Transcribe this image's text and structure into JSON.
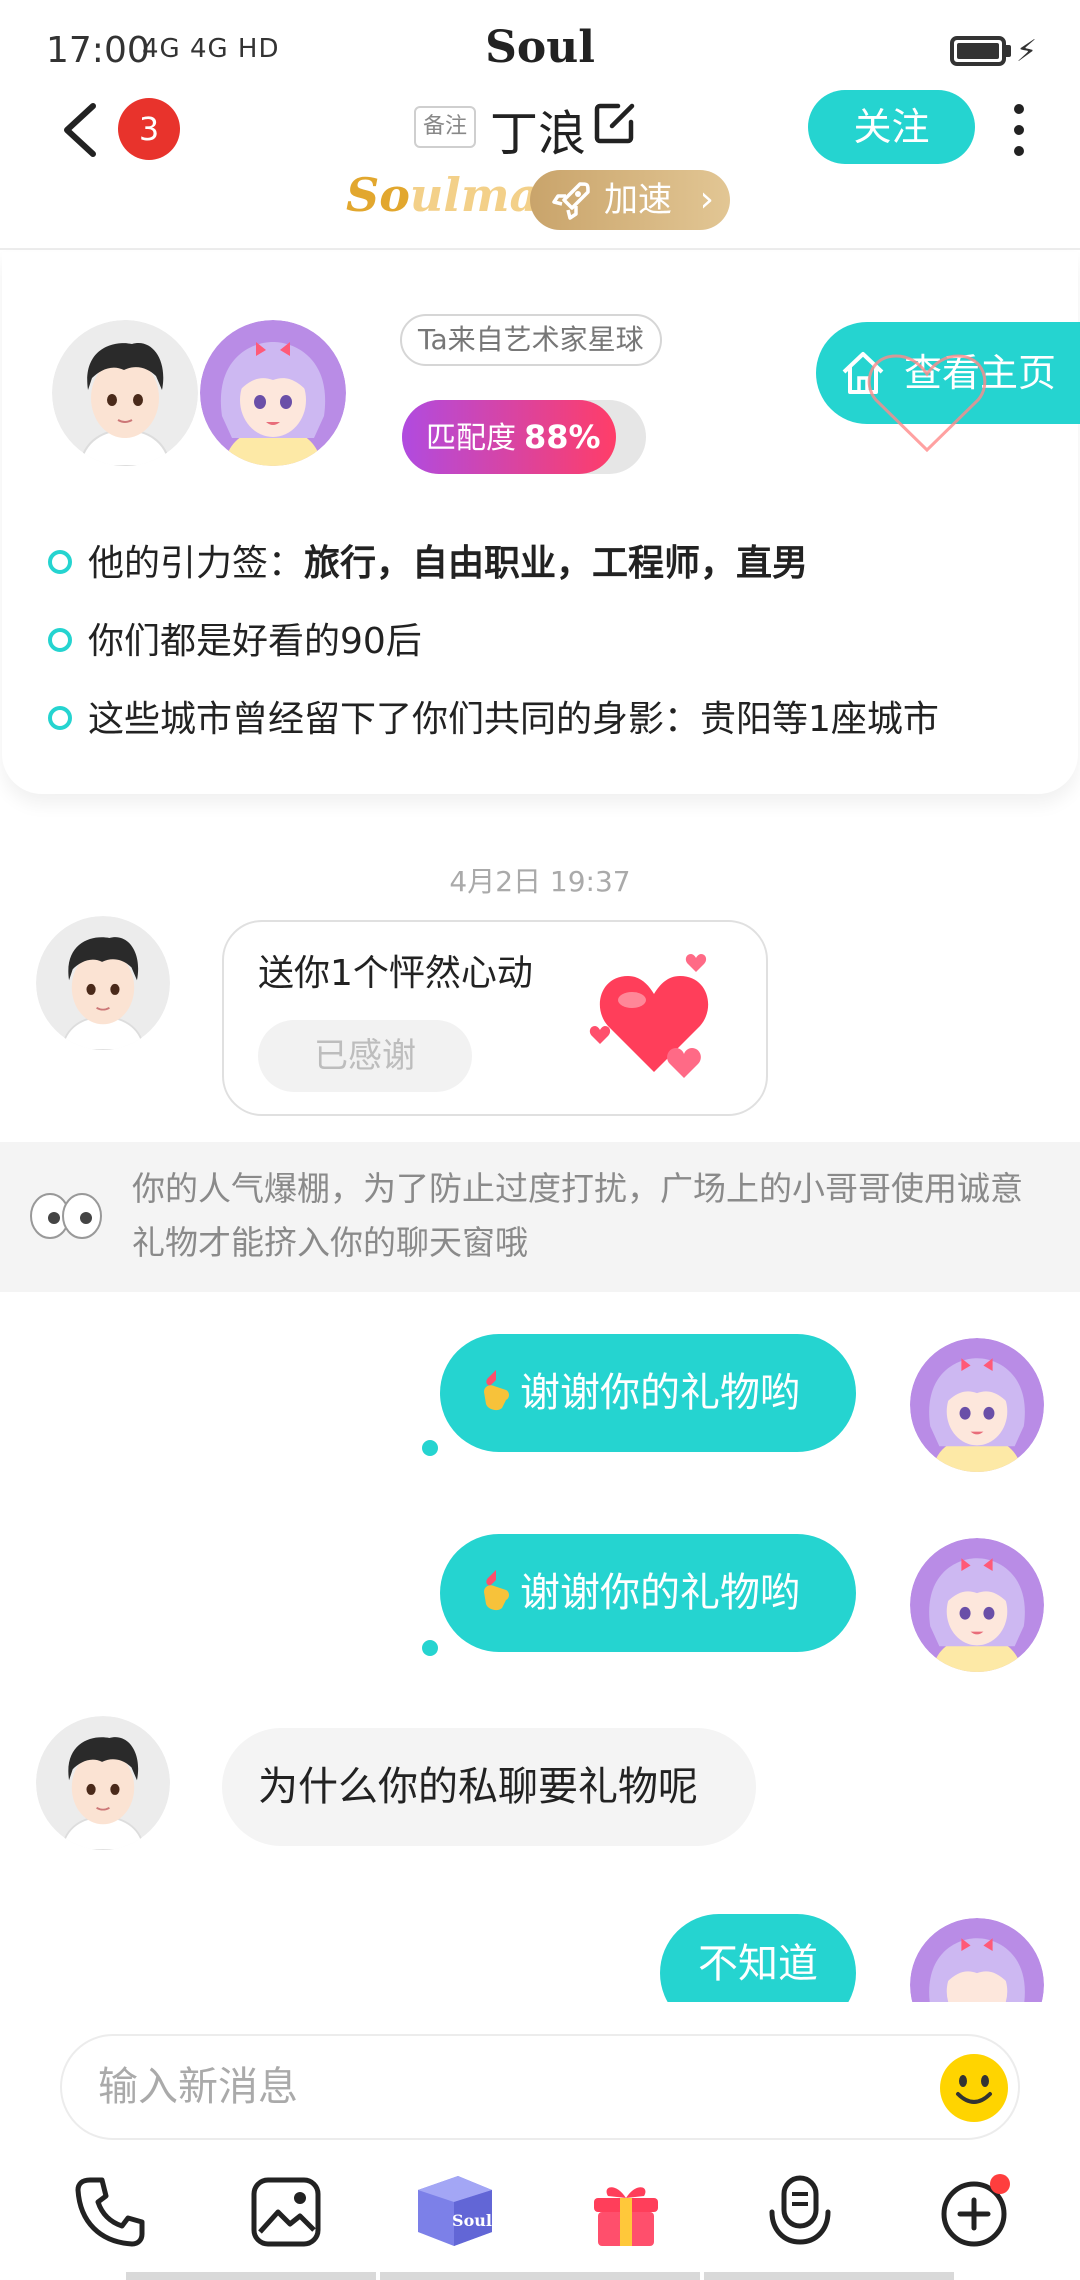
{
  "status_bar": {
    "time": "17:00",
    "network": "4G 4G HD",
    "app_name": "Soul"
  },
  "header": {
    "unread_count": "3",
    "remark_label": "备注",
    "contact_name": "丁浪",
    "follow_label": "关注",
    "soulmate_brand": "Soulmate",
    "speedup_label": "加速",
    "accent_color": "#25d4d0"
  },
  "match_card": {
    "origin": "Ta来自艺术家星球",
    "match_label": "匹配度",
    "match_value": "88%",
    "match_fraction": 0.88,
    "homepage_label": "查看主页",
    "tags_prefix": "他的引力签：",
    "tags": "旅行，自由职业，工程师，直男",
    "common_line": "你们都是好看的90后",
    "cities_line": "这些城市曾经留下了你们共同的身影：贵阳等1座城市"
  },
  "chat": {
    "timestamp": "4月2日 19:37",
    "gift_text": "送你1个怦然心动",
    "gift_status": "已感谢",
    "notice": "你的人气爆棚，为了防止过度打扰，广场上的小哥哥使用诚意礼物才能挤入你的聊天窗哦",
    "messages": [
      {
        "from": "me",
        "text": "谢谢你的礼物哟",
        "emoji": "hand-heart"
      },
      {
        "from": "me",
        "text": "谢谢你的礼物哟",
        "emoji": "hand-heart"
      },
      {
        "from": "them",
        "text": "为什么你的私聊要礼物呢"
      },
      {
        "from": "me",
        "text": "不知道"
      }
    ]
  },
  "input": {
    "placeholder": "输入新消息"
  },
  "toolbar": {
    "icons": [
      "phone-icon",
      "image-icon",
      "soul-box-icon",
      "gift-icon",
      "voice-icon",
      "plus-icon"
    ],
    "box_label": "Soul"
  }
}
